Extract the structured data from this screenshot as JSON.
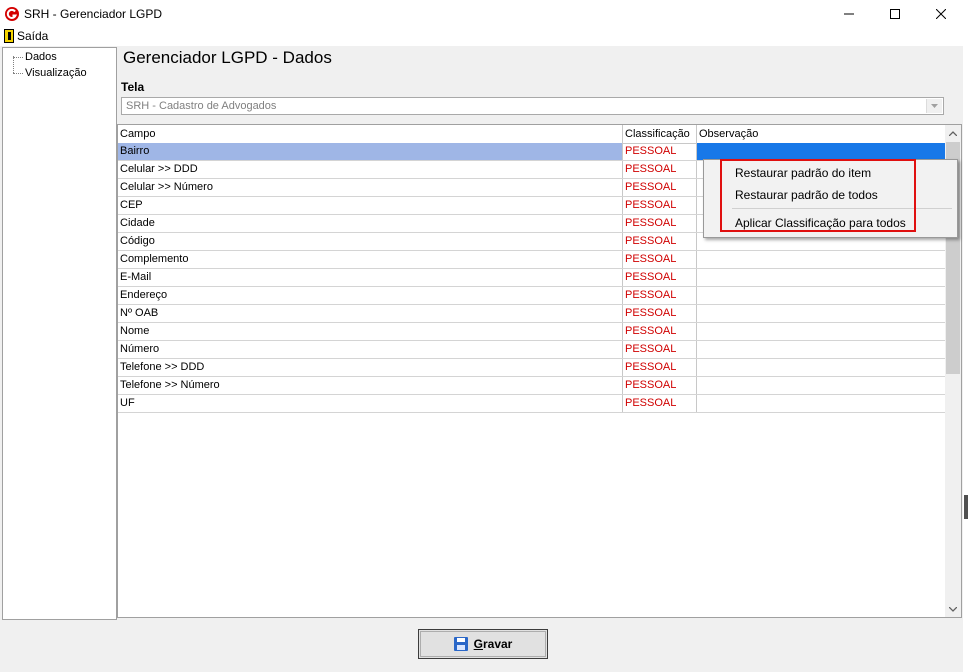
{
  "window": {
    "title": "SRH - Gerenciador LGPD",
    "minimize_glyph": "—",
    "maximize_glyph": "☐",
    "close_glyph": "✕",
    "accent_color": "#d40000"
  },
  "menu": {
    "items": [
      {
        "label": "Saída",
        "icon": "exit-door-icon"
      }
    ]
  },
  "tree": {
    "items": [
      {
        "label": "Dados"
      },
      {
        "label": "Visualização"
      }
    ]
  },
  "main": {
    "heading": "Gerenciador LGPD - Dados",
    "tela_label": "Tela",
    "tela_value": "SRH - Cadastro de Advogados"
  },
  "grid": {
    "columns": [
      "Campo",
      "Classificação",
      "Observação"
    ],
    "selected_row_index": 0,
    "classification_color": "#d00000",
    "rows": [
      {
        "campo": "Bairro",
        "classificacao": "PESSOAL",
        "observacao": ""
      },
      {
        "campo": "Celular >> DDD",
        "classificacao": "PESSOAL",
        "observacao": ""
      },
      {
        "campo": "Celular >> Número",
        "classificacao": "PESSOAL",
        "observacao": ""
      },
      {
        "campo": "CEP",
        "classificacao": "PESSOAL",
        "observacao": ""
      },
      {
        "campo": "Cidade",
        "classificacao": "PESSOAL",
        "observacao": ""
      },
      {
        "campo": "Código",
        "classificacao": "PESSOAL",
        "observacao": ""
      },
      {
        "campo": "Complemento",
        "classificacao": "PESSOAL",
        "observacao": ""
      },
      {
        "campo": "E-Mail",
        "classificacao": "PESSOAL",
        "observacao": ""
      },
      {
        "campo": "Endereço",
        "classificacao": "PESSOAL",
        "observacao": ""
      },
      {
        "campo": "Nº OAB",
        "classificacao": "PESSOAL",
        "observacao": ""
      },
      {
        "campo": "Nome",
        "classificacao": "PESSOAL",
        "observacao": ""
      },
      {
        "campo": "Número",
        "classificacao": "PESSOAL",
        "observacao": ""
      },
      {
        "campo": "Telefone >> DDD",
        "classificacao": "PESSOAL",
        "observacao": ""
      },
      {
        "campo": "Telefone >> Número",
        "classificacao": "PESSOAL",
        "observacao": ""
      },
      {
        "campo": "UF",
        "classificacao": "PESSOAL",
        "observacao": ""
      }
    ]
  },
  "context_menu": {
    "items": [
      {
        "label": "Restaurar padrão do item"
      },
      {
        "label": "Restaurar padrão de todos"
      },
      {
        "label": "Aplicar Classificação para todos"
      }
    ]
  },
  "footer": {
    "save_label": "Gravar",
    "save_icon": "floppy-disk-icon"
  }
}
